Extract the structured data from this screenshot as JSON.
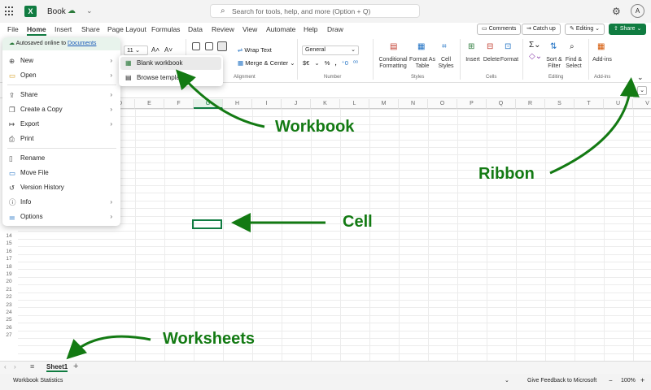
{
  "titlebar": {
    "doc_name": "Book",
    "search_placeholder": "Search for tools, help, and more (Option + Q)",
    "avatar_initial": "A"
  },
  "tabs": [
    "File",
    "Home",
    "Insert",
    "Share",
    "Page Layout",
    "Formulas",
    "Data",
    "Review",
    "View",
    "Automate",
    "Help",
    "Draw"
  ],
  "header_buttons": {
    "comments": "Comments",
    "catchup": "Catch up",
    "editing": "Editing",
    "share": "Share"
  },
  "ribbon": {
    "font_size": "11",
    "wrap_text": "Wrap Text",
    "merge_center": "Merge & Center",
    "alignment_group": "Alignment",
    "number_format": "General",
    "number_group": "Number",
    "conditional_formatting": [
      "Conditional",
      "Formatting"
    ],
    "format_as_table": [
      "Format As",
      "Table"
    ],
    "cell_styles": [
      "Cell",
      "Styles"
    ],
    "styles_group": "Styles",
    "insert": "Insert",
    "delete": "Delete",
    "format": "Format",
    "cells_group": "Cells",
    "sort_filter": [
      "Sort &",
      "Filter"
    ],
    "find_select": [
      "Find &",
      "Select"
    ],
    "editing_group": "Editing",
    "addins": "Add-ins",
    "addins_group": "Add-ins"
  },
  "file_menu": {
    "autosave_text": "Autosaved online to",
    "autosave_link": "Documents",
    "items": [
      "New",
      "Open",
      "Share",
      "Create a Copy",
      "Export",
      "Print",
      "Rename",
      "Move File",
      "Version History",
      "Info",
      "Options"
    ],
    "submenu": [
      "Blank workbook",
      "Browse templates"
    ]
  },
  "columns": [
    "D",
    "E",
    "F",
    "G",
    "H",
    "I",
    "J",
    "K",
    "L",
    "M",
    "N",
    "O",
    "P",
    "Q",
    "R",
    "S",
    "T",
    "U",
    "V"
  ],
  "selected_column": "G",
  "rows": [
    "14",
    "15",
    "16",
    "17",
    "18",
    "19",
    "20",
    "21",
    "22",
    "23",
    "24",
    "25",
    "26",
    "27"
  ],
  "sheet_tab": "Sheet1",
  "status": {
    "left": "Workbook Statistics",
    "feedback": "Give Feedback to Microsoft",
    "zoom": "100%"
  },
  "annotations": {
    "workbook": "Workbook",
    "ribbon": "Ribbon",
    "cell": "Cell",
    "worksheets": "Worksheets"
  },
  "colors": {
    "accent": "#107c41",
    "annotation": "#137a13"
  }
}
